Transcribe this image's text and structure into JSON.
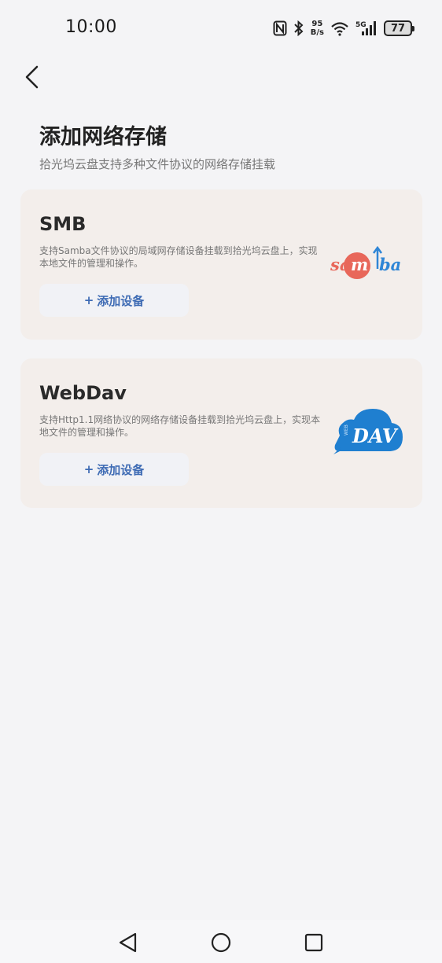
{
  "status_bar": {
    "time": "10:00",
    "net_speed_value": "95",
    "net_speed_unit": "B/s",
    "network_type": "5G",
    "battery": "77",
    "icons": [
      "nfc-icon",
      "bluetooth-icon",
      "wifi-icon",
      "signal-icon",
      "battery-icon"
    ]
  },
  "header": {
    "title": "添加网络存储",
    "subtitle": "拾光坞云盘支持多种文件协议的网络存储挂载"
  },
  "cards": [
    {
      "title": "SMB",
      "description": "支持Samba文件协议的局域网存储设备挂载到拾光坞云盘上，实现本地文件的管理和操作。",
      "button_plus": "+",
      "button_label": "添加设备",
      "logo_text": "samba"
    },
    {
      "title": "WebDav",
      "description": "支持Http1.1网络协议的网络存储设备挂载到拾光坞云盘上，实现本地文件的管理和操作。",
      "button_plus": "+",
      "button_label": "添加设备",
      "logo_text": "DAV",
      "logo_small_text": "WEB"
    }
  ],
  "colors": {
    "background": "#f4f4f6",
    "card": "#f3eeeb",
    "button_text": "#3e6bb4",
    "samba_red": "#e8675a",
    "samba_blue": "#2f86d6",
    "dav_blue": "#1f7fd0"
  }
}
